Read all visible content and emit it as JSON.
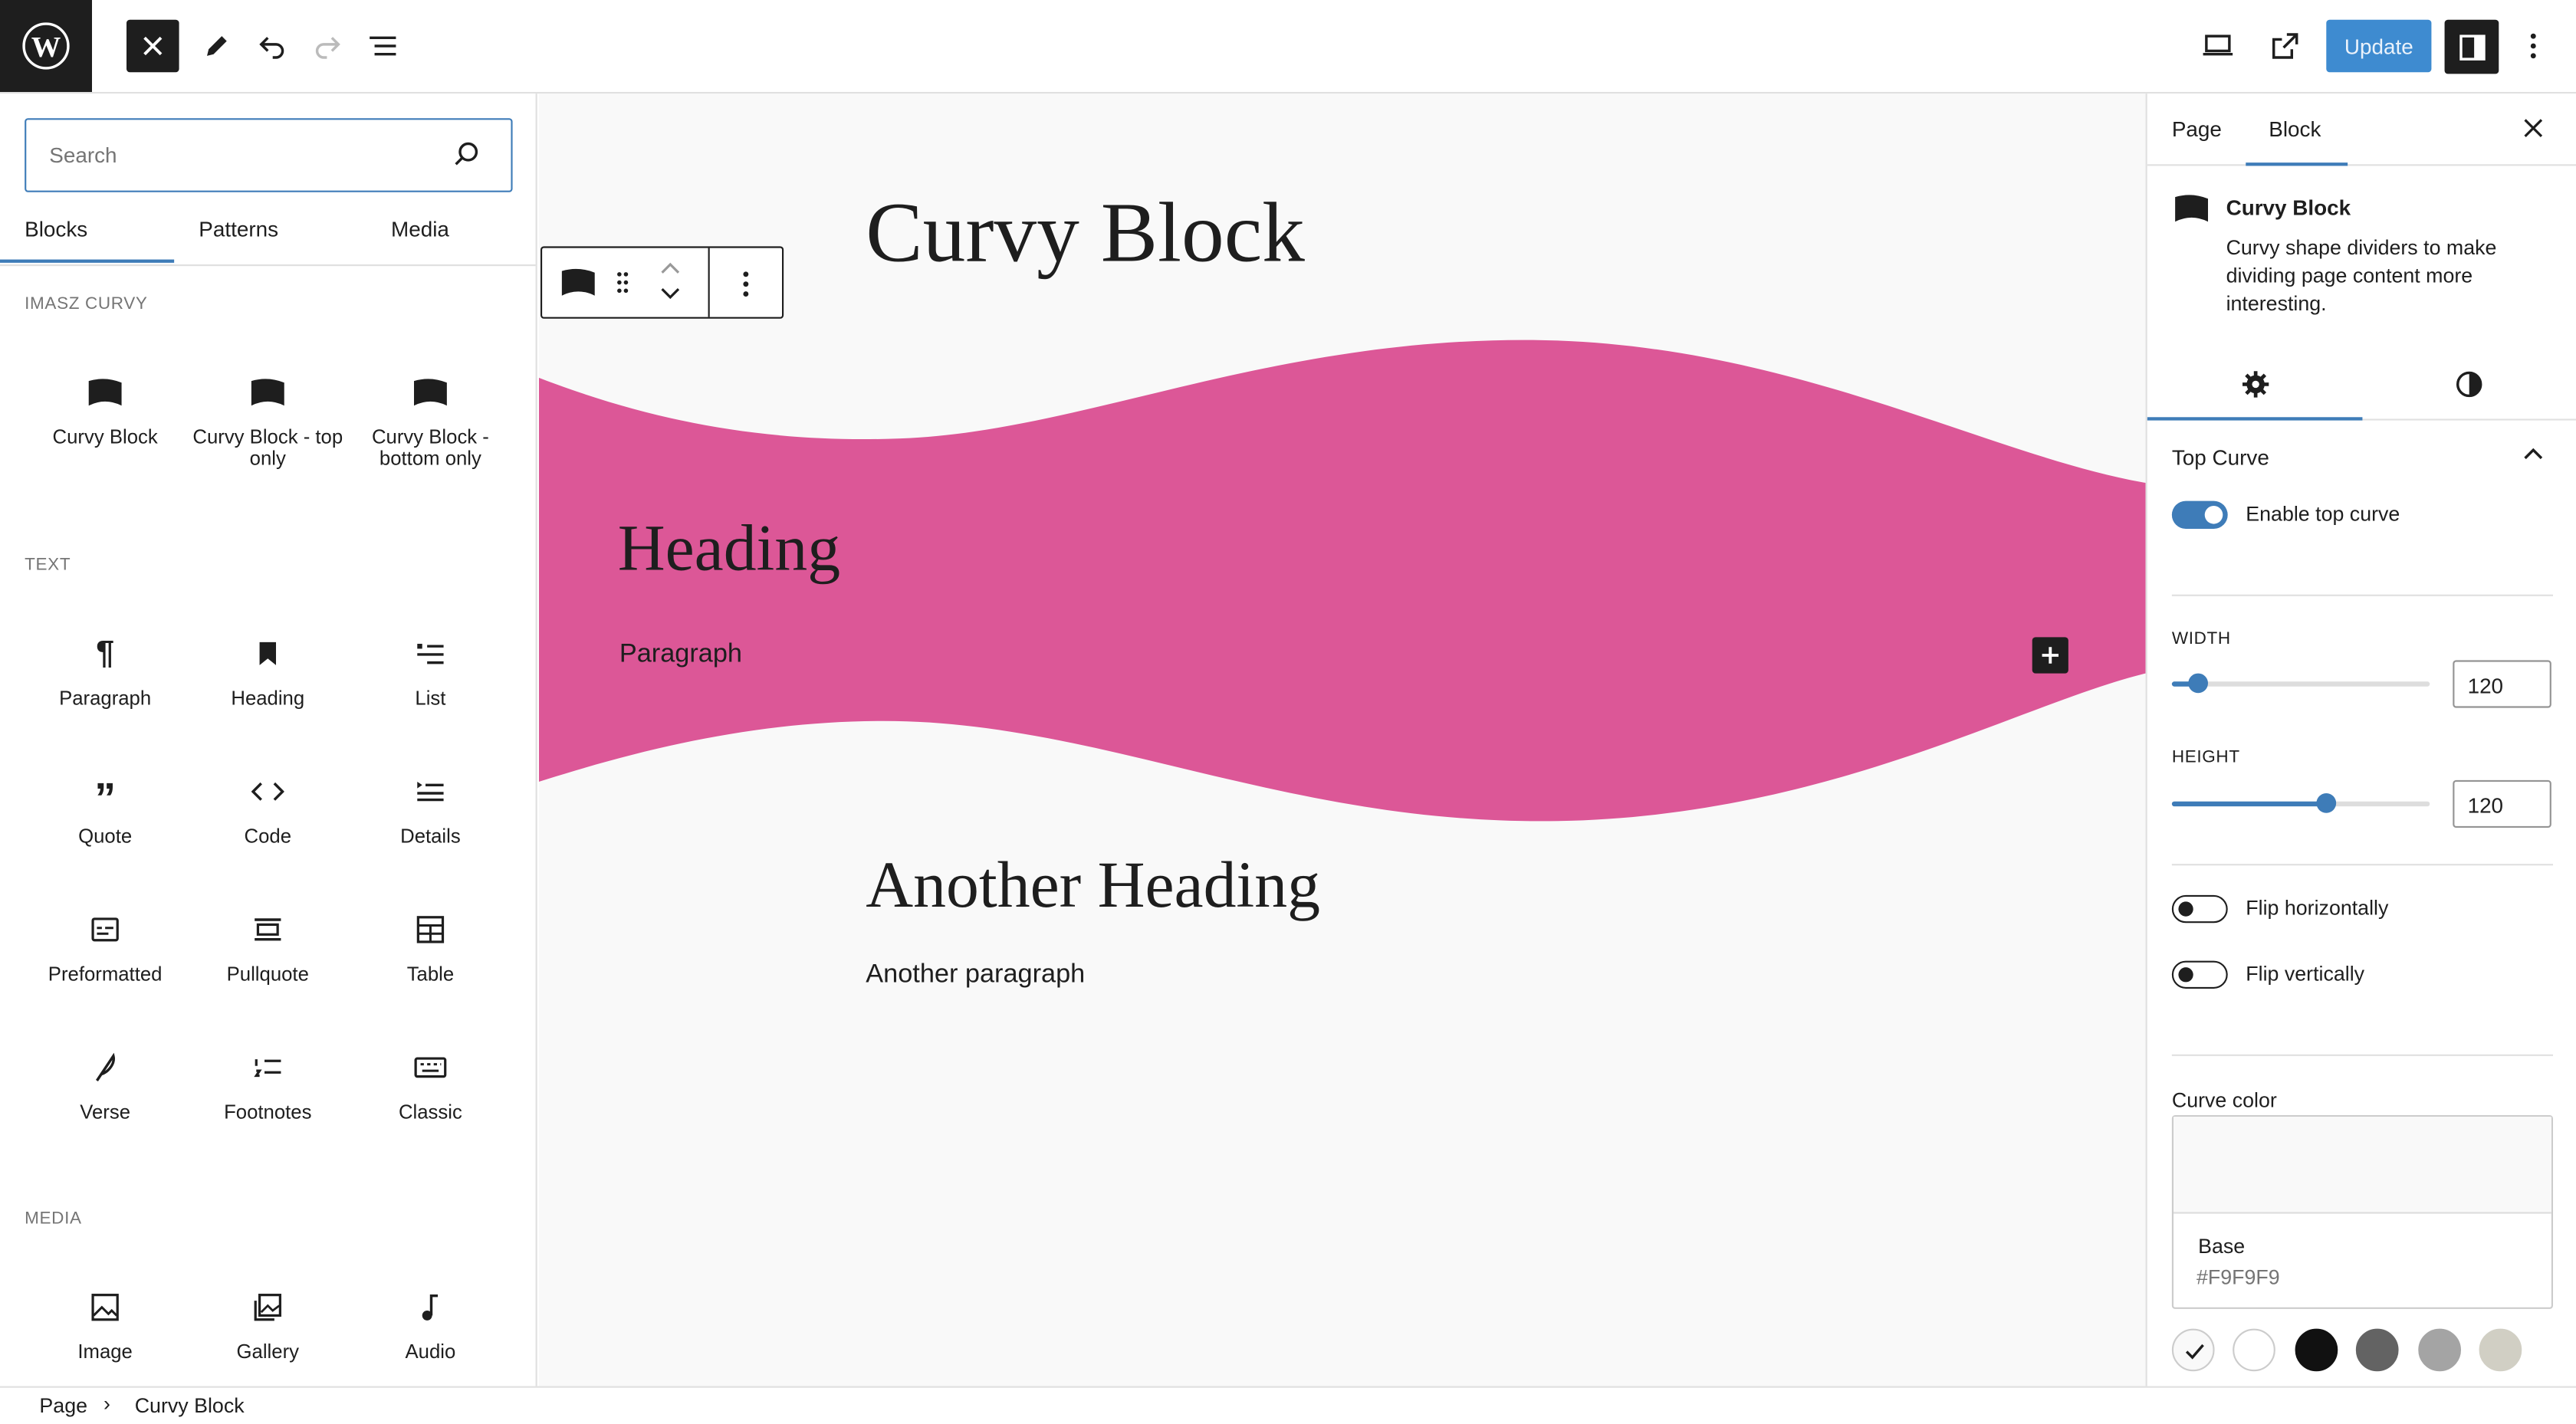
{
  "topbar": {
    "update_label": "Update"
  },
  "inserter": {
    "search_placeholder": "Search",
    "tabs": [
      "Blocks",
      "Patterns",
      "Media"
    ],
    "categories": {
      "curvy": "IMASZ CURVY",
      "text": "TEXT",
      "media": "MEDIA"
    },
    "curvy_blocks": [
      "Curvy Block",
      "Curvy Block - top only",
      "Curvy Block - bottom only"
    ],
    "text_blocks": [
      "Paragraph",
      "Heading",
      "List",
      "Quote",
      "Code",
      "Details",
      "Preformatted",
      "Pullquote",
      "Table",
      "Verse",
      "Footnotes",
      "Classic"
    ],
    "media_blocks": [
      "Image",
      "Gallery",
      "Audio"
    ]
  },
  "canvas": {
    "title": "Curvy Block",
    "inner_heading": "Heading",
    "inner_paragraph": "Paragraph",
    "another_heading": "Another Heading",
    "another_paragraph": "Another paragraph",
    "curve_color": "#dc5797",
    "canvas_bg": "#f9f9f9"
  },
  "settings": {
    "tabs": [
      "Page",
      "Block"
    ],
    "block_title": "Curvy Block",
    "block_description": "Curvy shape dividers to make dividing page content more interesting.",
    "panel_title": "Top Curve",
    "enable_top_curve_label": "Enable top curve",
    "width_label": "WIDTH",
    "width_value": "120",
    "height_label": "HEIGHT",
    "height_value": "120",
    "width_slider_fraction": 0.1,
    "height_slider_fraction": 0.6,
    "flip_horizontally_label": "Flip horizontally",
    "flip_vertically_label": "Flip vertically",
    "enable_top_curve": true,
    "flip_horizontally": false,
    "flip_vertically": false,
    "curve_color_label": "Curve color",
    "selected_color_name": "Base",
    "selected_color_hex": "#F9F9F9",
    "palette": [
      "#f9f9f9",
      "#ffffff",
      "#111111",
      "#636363",
      "#a4a4a4",
      "#d1cfc4"
    ]
  },
  "breadcrumb": [
    "Page",
    "Curvy Block"
  ]
}
